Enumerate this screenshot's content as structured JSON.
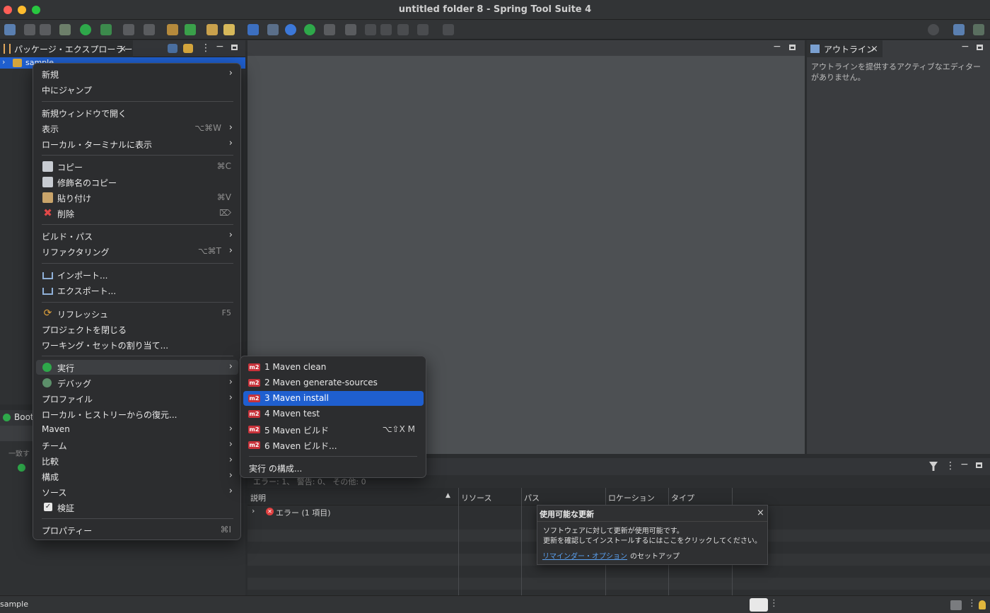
{
  "window": {
    "title": "untitled folder 8 - Spring Tool Suite 4"
  },
  "package_explorer": {
    "tab_label": "パッケージ・エクスプローラー",
    "project": "sample"
  },
  "boot_dashboard": {
    "tab_label": "Boot",
    "filter_label": "一致す"
  },
  "outline": {
    "tab_label": "アウトライン",
    "message": "アウトラインを提供するアクティブなエディターがありません。"
  },
  "context_menu": {
    "items": [
      {
        "label": "新規",
        "submenu": true
      },
      {
        "label": "中にジャンプ"
      },
      {
        "label": "新規ウィンドウで開く"
      },
      {
        "label": "表示",
        "shortcut": "⌥⌘W",
        "submenu": true
      },
      {
        "label": "ローカル・ターミナルに表示",
        "submenu": true
      },
      {
        "label": "コピー",
        "shortcut": "⌘C",
        "icon": "copy-icon"
      },
      {
        "label": "修飾名のコピー",
        "icon": "qualified-copy-icon"
      },
      {
        "label": "貼り付け",
        "shortcut": "⌘V",
        "icon": "paste-icon"
      },
      {
        "label": "削除",
        "shortcut": "⌦",
        "icon": "delete-icon"
      },
      {
        "label": "ビルド・パス",
        "submenu": true
      },
      {
        "label": "リファクタリング",
        "shortcut": "⌥⌘T",
        "submenu": true
      },
      {
        "label": "インポート...",
        "icon": "import-icon"
      },
      {
        "label": "エクスポート...",
        "icon": "export-icon"
      },
      {
        "label": "リフレッシュ",
        "shortcut": "F5",
        "icon": "refresh-icon"
      },
      {
        "label": "プロジェクトを閉じる"
      },
      {
        "label": "ワーキング・セットの割り当て..."
      },
      {
        "label": "実行",
        "submenu": true,
        "icon": "run-icon"
      },
      {
        "label": "デバッグ",
        "submenu": true,
        "icon": "debug-icon"
      },
      {
        "label": "プロファイル",
        "submenu": true
      },
      {
        "label": "ローカル・ヒストリーからの復元..."
      },
      {
        "label": "Maven",
        "submenu": true
      },
      {
        "label": "チーム",
        "submenu": true
      },
      {
        "label": "比較",
        "submenu": true
      },
      {
        "label": "構成",
        "submenu": true
      },
      {
        "label": "ソース",
        "submenu": true
      },
      {
        "label": "検証",
        "icon": "checkbox-icon"
      },
      {
        "label": "プロパティー",
        "shortcut": "⌘I"
      }
    ]
  },
  "run_submenu": {
    "icon_text": "m2",
    "items": [
      {
        "label": "1 Maven clean"
      },
      {
        "label": "2 Maven generate-sources"
      },
      {
        "label": "3 Maven install",
        "selected": true
      },
      {
        "label": "4 Maven test"
      },
      {
        "label": "5 Maven ビルド",
        "shortcut": "⌥⇧X M"
      },
      {
        "label": "6 Maven ビルド..."
      },
      {
        "label": "実行 の構成..."
      }
    ]
  },
  "problems": {
    "summary": "エラー: 1、 警告: 0、 その他: 0",
    "columns": [
      "説明",
      "リソース",
      "パス",
      "ロケーション",
      "タイプ"
    ],
    "rows": [
      {
        "label": "エラー (1 項目)"
      }
    ]
  },
  "update_notification": {
    "title": "使用可能な更新",
    "line1": "ソフトウェアに対して更新が使用可能です。",
    "line2": "更新を確認してインストールするにはここをクリックしてください。",
    "link": "リマインダー・オプション",
    "link_suffix": " のセットアップ"
  },
  "status_bar": {
    "text": "sample"
  },
  "colors": {
    "selection": "#1f5fcf",
    "error": "#e04040",
    "maven": "#c8323a",
    "link": "#5aa0f0"
  }
}
